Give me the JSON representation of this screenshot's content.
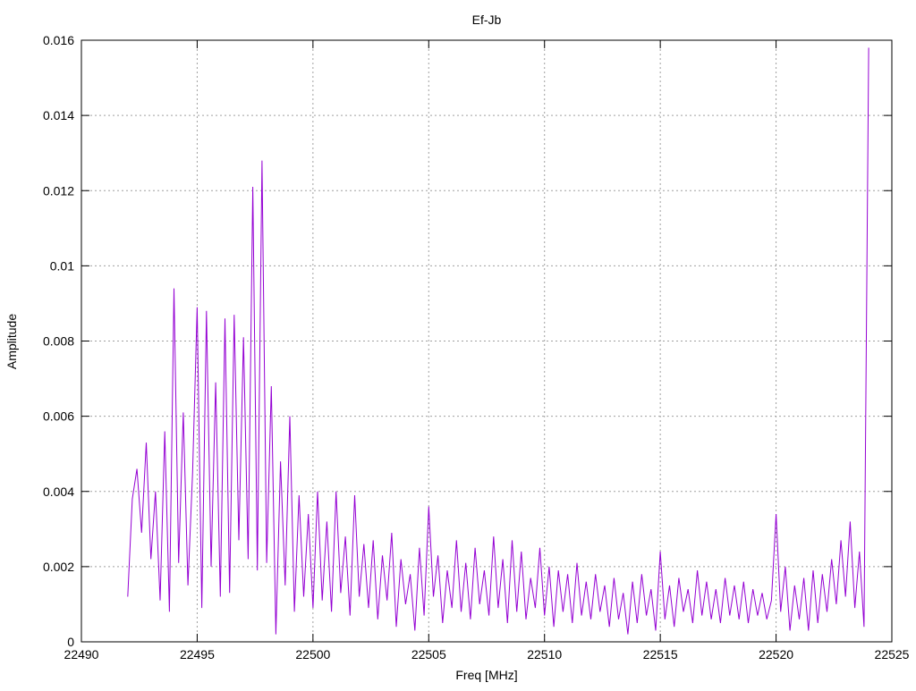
{
  "chart_data": {
    "type": "line",
    "title": "Ef-Jb",
    "xlabel": "Freq [MHz]",
    "ylabel": "Amplitude",
    "xlim": [
      22490,
      22525
    ],
    "ylim": [
      0,
      0.016
    ],
    "grid": true,
    "xticks": [
      "22490",
      "22495",
      "22500",
      "22505",
      "22510",
      "22515",
      "22520",
      "22525"
    ],
    "xtick_values": [
      22490,
      22495,
      22500,
      22505,
      22510,
      22515,
      22520,
      22525
    ],
    "yticks": [
      "0",
      "0.002",
      "0.004",
      "0.006",
      "0.008",
      "0.01",
      "0.012",
      "0.014",
      "0.016"
    ],
    "ytick_values": [
      0,
      0.002,
      0.004,
      0.006,
      0.008,
      0.01,
      0.012,
      0.014,
      0.016
    ],
    "series": [
      {
        "name": "Ef-Jb",
        "color": "#9400d3",
        "x_start": 22492.0,
        "x_step": 0.2,
        "values": [
          0.0012,
          0.0038,
          0.0046,
          0.0029,
          0.0053,
          0.0022,
          0.004,
          0.0011,
          0.0056,
          0.0008,
          0.0094,
          0.0021,
          0.0061,
          0.0015,
          0.0045,
          0.0089,
          0.0009,
          0.0088,
          0.002,
          0.0069,
          0.0012,
          0.0086,
          0.0013,
          0.0087,
          0.0027,
          0.0081,
          0.0022,
          0.0121,
          0.0019,
          0.0128,
          0.0021,
          0.0068,
          0.0002,
          0.0048,
          0.0015,
          0.006,
          0.0008,
          0.0039,
          0.0012,
          0.0034,
          0.0009,
          0.004,
          0.0011,
          0.0032,
          0.0008,
          0.004,
          0.0013,
          0.0028,
          0.0007,
          0.0039,
          0.0012,
          0.0026,
          0.0009,
          0.0027,
          0.0006,
          0.0023,
          0.0011,
          0.0029,
          0.0004,
          0.0022,
          0.001,
          0.0018,
          0.0003,
          0.0025,
          0.0007,
          0.0036,
          0.0012,
          0.0023,
          0.0005,
          0.0019,
          0.0009,
          0.0027,
          0.0008,
          0.0021,
          0.0006,
          0.0025,
          0.001,
          0.0019,
          0.0007,
          0.0028,
          0.0009,
          0.0022,
          0.0005,
          0.0027,
          0.0008,
          0.0024,
          0.0006,
          0.0017,
          0.0009,
          0.0025,
          0.0007,
          0.002,
          0.0004,
          0.0019,
          0.0008,
          0.0018,
          0.0005,
          0.0021,
          0.0007,
          0.0016,
          0.0006,
          0.0018,
          0.0008,
          0.0015,
          0.0004,
          0.0017,
          0.0006,
          0.0013,
          0.0002,
          0.0016,
          0.0005,
          0.0018,
          0.0007,
          0.0014,
          0.0003,
          0.0024,
          0.0006,
          0.0015,
          0.0004,
          0.0017,
          0.0008,
          0.0014,
          0.0005,
          0.0019,
          0.0007,
          0.0016,
          0.0006,
          0.0014,
          0.0005,
          0.0017,
          0.0007,
          0.0015,
          0.0006,
          0.0016,
          0.0005,
          0.0014,
          0.0007,
          0.0013,
          0.0006,
          0.0011,
          0.0034,
          0.0008,
          0.002,
          0.0003,
          0.0015,
          0.0006,
          0.0017,
          0.0003,
          0.0019,
          0.0005,
          0.0018,
          0.0008,
          0.0022,
          0.001,
          0.0027,
          0.0012,
          0.0032,
          0.0009,
          0.0024,
          0.0004,
          0.0158
        ]
      }
    ]
  }
}
